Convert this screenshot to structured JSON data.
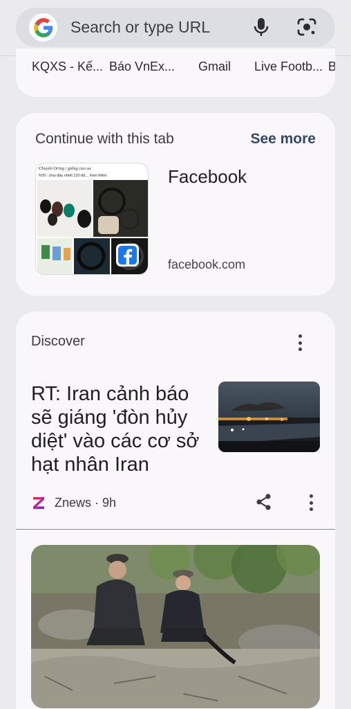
{
  "search": {
    "placeholder": "Search or type URL"
  },
  "shortcuts": [
    {
      "label": "KQXS - Kế..."
    },
    {
      "label": "Báo VnEx..."
    },
    {
      "label": "Gmail"
    },
    {
      "label": "Live Footb..."
    },
    {
      "label": "B"
    }
  ],
  "continue_tab": {
    "heading": "Continue with this tab",
    "see_more": "See more",
    "title": "Facebook",
    "url": "facebook.com",
    "thumb_caption_1": "Chuyên Oring / giống cao su",
    "thumb_caption_2": "N70 : chịu dầu nhiệt 120 độ... Xem thêm"
  },
  "discover": {
    "title": "Discover",
    "article": {
      "headline": "RT: Iran cảnh báo sẽ giáng 'đòn hủy diệt' vào các cơ sở hạt nhân Iran",
      "source_logo": "Z",
      "source": "Znews · 9h"
    }
  },
  "icons": {
    "google": "google-logo-icon",
    "mic": "mic-icon",
    "lens": "lens-icon",
    "share": "share-icon",
    "more": "more-vert-icon"
  },
  "colors": {
    "page_bg": "#ebebee",
    "card_bg": "#faf7fb",
    "see_more": "#36466a",
    "znews_magenta": "#c0259b",
    "facebook_blue": "#1877f2"
  }
}
